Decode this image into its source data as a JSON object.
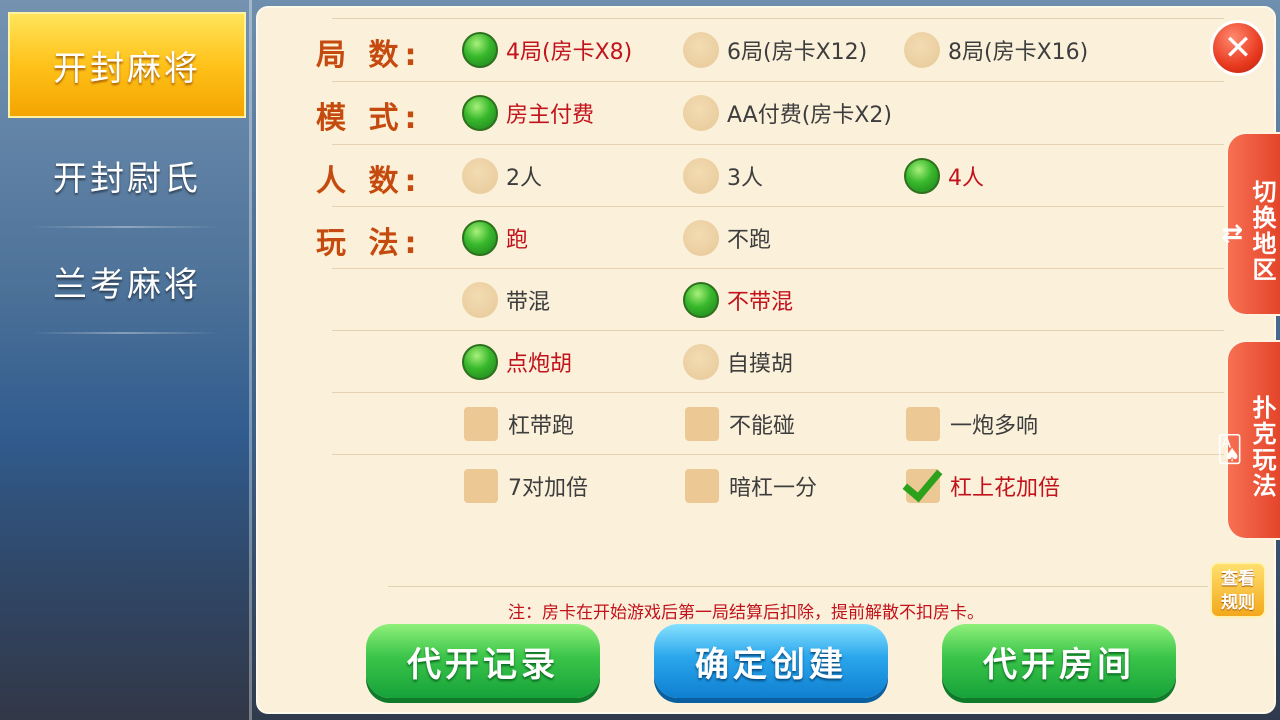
{
  "sidebar": {
    "items": [
      {
        "label": "开封麻将",
        "active": true
      },
      {
        "label": "开封尉氏",
        "active": false
      },
      {
        "label": "兰考麻将",
        "active": false
      }
    ]
  },
  "labels": {
    "rounds": "局 数:",
    "mode": "模 式:",
    "players": "人 数:",
    "play": "玩 法:"
  },
  "rounds": [
    "4局(房卡X8)",
    "6局(房卡X12)",
    "8局(房卡X16)"
  ],
  "mode": [
    "房主付费",
    "AA付费(房卡X2)"
  ],
  "players": [
    "2人",
    "3人",
    "4人"
  ],
  "play_run": [
    "跑",
    "不跑"
  ],
  "play_mix": [
    "带混",
    "不带混"
  ],
  "play_hu": [
    "点炮胡",
    "自摸胡"
  ],
  "checks_row1": [
    "杠带跑",
    "不能碰",
    "一炮多响"
  ],
  "checks_row2": [
    "7对加倍",
    "暗杠一分",
    "杠上花加倍"
  ],
  "note": "注：房卡在开始游戏后第一局结算后扣除，提前解散不扣房卡。",
  "buttons": {
    "record": "代开记录",
    "create": "确定创建",
    "proxy": "代开房间"
  },
  "right_tabs": {
    "switch_region": "切换地区",
    "switch_icon": "⇄",
    "poker": "扑克玩法",
    "poker_icon": "🂡"
  },
  "rules_button": "查看规则",
  "close_icon": "✕",
  "colors": {
    "panel_bg": "#fbf1db",
    "label_color": "#c44a10",
    "selected_text": "#c2121b",
    "green_button": "#3ac449",
    "blue_button": "#2aa6ec"
  }
}
